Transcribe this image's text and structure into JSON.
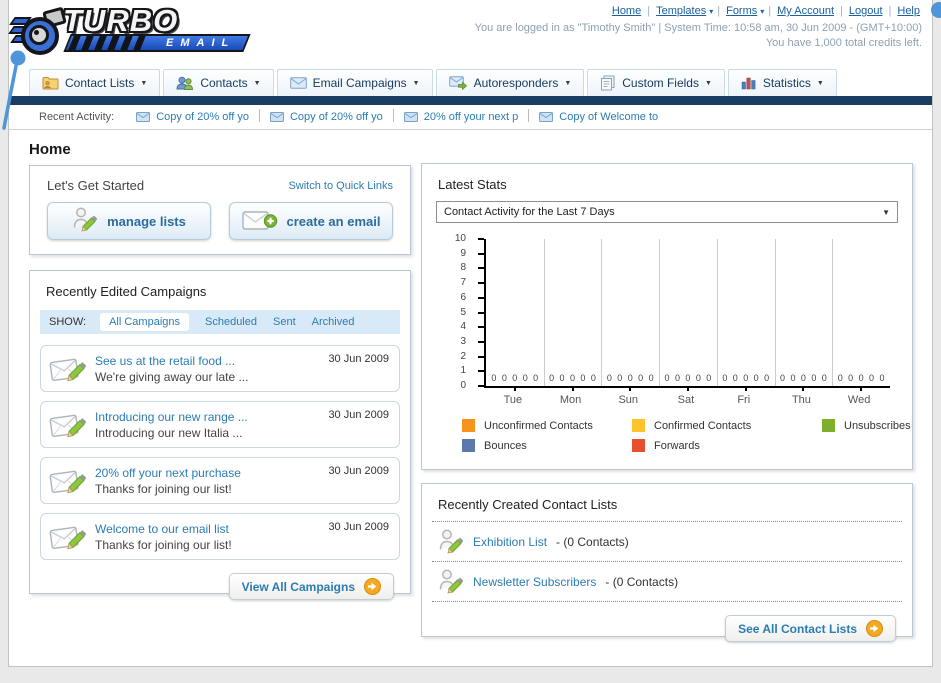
{
  "header": {
    "logo": {
      "line1": "TURBO",
      "line2": "EMAIL"
    },
    "nav_links": [
      {
        "label": "Home",
        "dropdown": false
      },
      {
        "label": "Templates",
        "dropdown": true
      },
      {
        "label": "Forms",
        "dropdown": true
      },
      {
        "label": "My Account",
        "dropdown": false
      },
      {
        "label": "Logout",
        "dropdown": false
      },
      {
        "label": "Help",
        "dropdown": false
      }
    ],
    "status_line1": "You are logged in as \"Timothy Smith\" | System Time: 10:58 am, 30 Jun 2009 - (GMT+10:00)",
    "status_line2": "You have 1,000 total credits left."
  },
  "tabs": [
    {
      "label": "Contact Lists",
      "icon": "contact-lists-icon"
    },
    {
      "label": "Contacts",
      "icon": "contacts-icon"
    },
    {
      "label": "Email Campaigns",
      "icon": "email-campaigns-icon"
    },
    {
      "label": "Autoresponders",
      "icon": "autoresponders-icon"
    },
    {
      "label": "Custom Fields",
      "icon": "custom-fields-icon"
    },
    {
      "label": "Statistics",
      "icon": "statistics-icon"
    }
  ],
  "recent_activity": {
    "label": "Recent Activity:",
    "items": [
      "Copy of 20% off yo",
      "Copy of 20% off yo",
      "20% off your next p",
      "Copy of Welcome to"
    ]
  },
  "page_title": "Home",
  "get_started": {
    "title": "Let's Get Started",
    "switch_link": "Switch to Quick Links",
    "manage_lists_label": "manage lists",
    "create_email_label": "create an email"
  },
  "campaigns": {
    "title": "Recently Edited Campaigns",
    "show_label": "SHOW:",
    "filters": [
      "All Campaigns",
      "Scheduled",
      "Sent",
      "Archived"
    ],
    "active_filter": "All Campaigns",
    "items": [
      {
        "title": "See us at the retail food ...",
        "subtitle": "We're giving away our late ...",
        "date": "30 Jun 2009"
      },
      {
        "title": "Introducing our new range ...",
        "subtitle": "Introducing our new Italia ...",
        "date": "30 Jun 2009"
      },
      {
        "title": "20% off your next purchase",
        "subtitle": "Thanks for joining our list!",
        "date": "30 Jun 2009"
      },
      {
        "title": "Welcome to our email list",
        "subtitle": "Thanks for joining our list!",
        "date": "30 Jun 2009"
      }
    ],
    "view_all_label": "View All Campaigns"
  },
  "stats": {
    "title": "Latest Stats",
    "dropdown_value": "Contact Activity for the Last 7 Days"
  },
  "chart_data": {
    "type": "bar",
    "title": "Contact Activity for the Last 7 Days",
    "categories": [
      "Tue",
      "Mon",
      "Sun",
      "Sat",
      "Fri",
      "Thu",
      "Wed"
    ],
    "series": [
      {
        "name": "Unconfirmed Contacts",
        "color": "#F7941E",
        "values": [
          0,
          0,
          0,
          0,
          0,
          0,
          0
        ]
      },
      {
        "name": "Confirmed Contacts",
        "color": "#FCC32C",
        "values": [
          0,
          0,
          0,
          0,
          0,
          0,
          0
        ]
      },
      {
        "name": "Unsubscribes",
        "color": "#7DAF2B",
        "values": [
          0,
          0,
          0,
          0,
          0,
          0,
          0
        ]
      },
      {
        "name": "Bounces",
        "color": "#5C79AE",
        "values": [
          0,
          0,
          0,
          0,
          0,
          0,
          0
        ]
      },
      {
        "name": "Forwards",
        "color": "#E8502D",
        "values": [
          0,
          0,
          0,
          0,
          0,
          0,
          0
        ]
      }
    ],
    "ylim": [
      0,
      10
    ],
    "ytick_step": 1,
    "grid": "vertical-group-separators",
    "value_labels": true,
    "legend_position": "bottom"
  },
  "contact_lists": {
    "title": "Recently Created Contact Lists",
    "items": [
      {
        "name": "Exhibition List",
        "suffix": " - (0 Contacts)"
      },
      {
        "name": "Newsletter Subscribers",
        "suffix": " - (0 Contacts)"
      }
    ],
    "see_all_label": "See All Contact Lists"
  },
  "colors": {
    "link": "#2B7CB3",
    "navy_bar": "#1A3E63",
    "accent_orange": "#F6A821",
    "show_bar_bg": "#D8E9F8"
  }
}
